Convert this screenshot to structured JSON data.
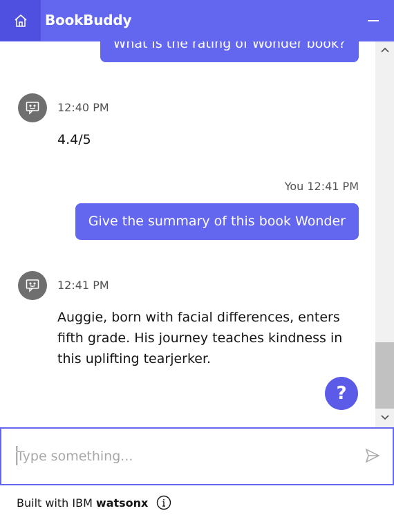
{
  "header": {
    "title": "BookBuddy",
    "home_icon": "home-icon",
    "minimize_icon": "minimize-icon",
    "brand_color": "#6366ee"
  },
  "messages": [
    {
      "sender": "user",
      "text": "What is the rating of Wonder book?"
    },
    {
      "sender": "bot",
      "time": "12:40 PM",
      "text": "4.4/5"
    },
    {
      "sender": "user",
      "meta": "You 12:41 PM",
      "text": "Give the summary of this book Wonder"
    },
    {
      "sender": "bot",
      "time": "12:41 PM",
      "text_lines": [
        "Auggie, born with facial differences, enters",
        "fifth grade. His journey teaches kindness in",
        "this uplifting tearjerker."
      ]
    }
  ],
  "help_button": {
    "label": "?"
  },
  "input": {
    "placeholder": "Type something...",
    "value": ""
  },
  "footer": {
    "prefix": "Built with IBM",
    "brand": "watsonx",
    "info_icon": "info-icon"
  }
}
